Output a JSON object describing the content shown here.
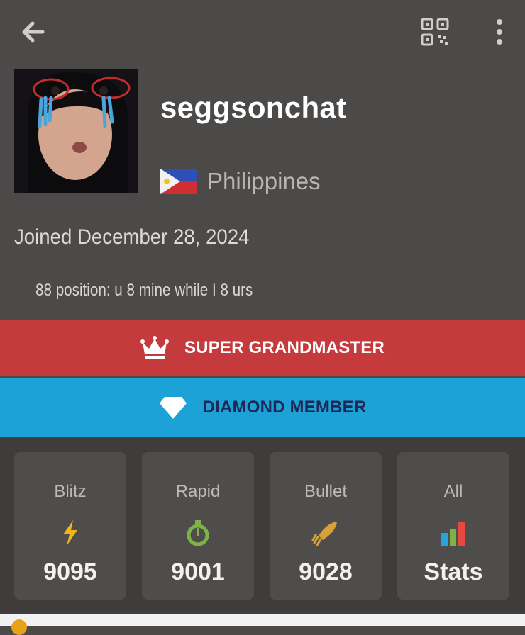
{
  "header": {
    "back_icon": "arrow-left-icon",
    "qr_icon": "qr-code-icon",
    "more_icon": "more-vertical-icon"
  },
  "profile": {
    "username": "seggsonchat",
    "country": "Philippines",
    "joined": "Joined December 28, 2024",
    "bio": "88 position: u 8 mine while I 8 urs"
  },
  "badges": [
    {
      "label": "SUPER GRANDMASTER",
      "icon": "crown-icon",
      "color": "#c53a3c"
    },
    {
      "label": "DIAMOND MEMBER",
      "icon": "diamond-icon",
      "color": "#1da2d7"
    }
  ],
  "ratings": [
    {
      "label": "Blitz",
      "value": "9095",
      "icon": "lightning-icon",
      "color": "#f2b416"
    },
    {
      "label": "Rapid",
      "value": "9001",
      "icon": "stopwatch-icon",
      "color": "#7cb342"
    },
    {
      "label": "Bullet",
      "value": "9028",
      "icon": "bullet-icon",
      "color": "#d7a13a"
    },
    {
      "label": "All",
      "value": "Stats",
      "icon": "bar-chart-icon",
      "color": "#e8a21a"
    }
  ]
}
